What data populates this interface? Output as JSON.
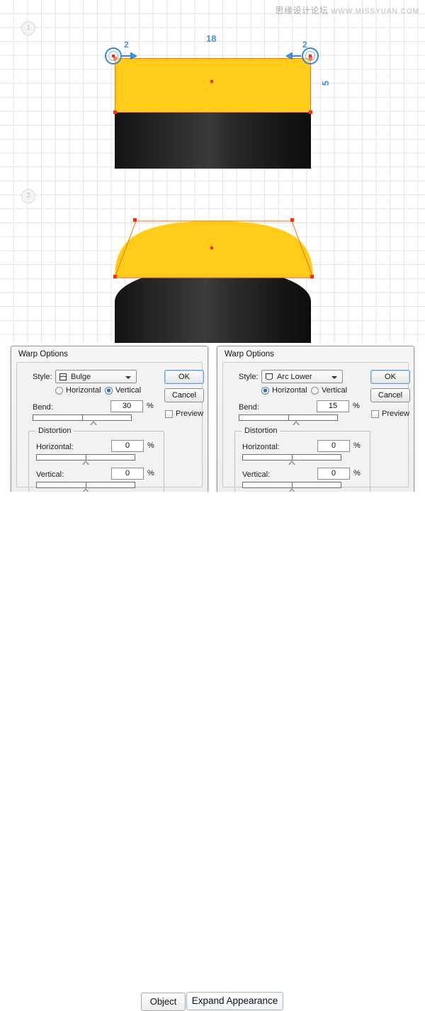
{
  "canvas": {
    "watermark_cn": "思缘设计论坛",
    "watermark_url": "WWW.MISSYUAN.COM",
    "step_badges": [
      {
        "label": "1"
      },
      {
        "label": "2"
      }
    ],
    "annotations": {
      "left_handle_number": "2",
      "right_handle_number": "2",
      "width_label": "18",
      "side_label": "5"
    },
    "colors": {
      "yellow_fill": "#ffcd19",
      "path_stroke": "#f36f21",
      "anchor_point": "#ff2a00",
      "handle_ring": "#3b87d6",
      "annotation_text": "#4a90d9",
      "dark_shape_dark": "#131313",
      "dark_shape_light": "#3c3c3c",
      "grid_line": "#e2e2e2"
    }
  },
  "dialogs": [
    {
      "title": "Warp Options",
      "style_label": "Style:",
      "style_value": "Bulge",
      "style_icon": "bulge-icon",
      "orientation": {
        "horizontal_label": "Horizontal",
        "vertical_label": "Vertical",
        "selected": "Vertical"
      },
      "bend": {
        "label": "Bend:",
        "value": "30",
        "unit": "%",
        "slider_percent": 65
      },
      "distortion": {
        "group_label": "Distortion",
        "horizontal": {
          "label": "Horizontal:",
          "value": "0",
          "unit": "%",
          "slider_percent": 50
        },
        "vertical": {
          "label": "Vertical:",
          "value": "0",
          "unit": "%",
          "slider_percent": 50
        }
      },
      "ok_label": "OK",
      "cancel_label": "Cancel",
      "preview_label": "Preview",
      "preview_checked": false
    },
    {
      "title": "Warp Options",
      "style_label": "Style:",
      "style_value": "Arc Lower",
      "style_icon": "arc-lower-icon",
      "orientation": {
        "horizontal_label": "Horizontal",
        "vertical_label": "Vertical",
        "selected": "Horizontal"
      },
      "bend": {
        "label": "Bend:",
        "value": "15",
        "unit": "%",
        "slider_percent": 60
      },
      "distortion": {
        "group_label": "Distortion",
        "horizontal": {
          "label": "Horizontal:",
          "value": "0",
          "unit": "%",
          "slider_percent": 50
        },
        "vertical": {
          "label": "Vertical:",
          "value": "0",
          "unit": "%",
          "slider_percent": 50
        }
      },
      "ok_label": "OK",
      "cancel_label": "Cancel",
      "preview_label": "Preview",
      "preview_checked": false
    }
  ],
  "bottom_bar": {
    "object_button": "Object",
    "expand_appearance_button": "Expand Appearance"
  }
}
